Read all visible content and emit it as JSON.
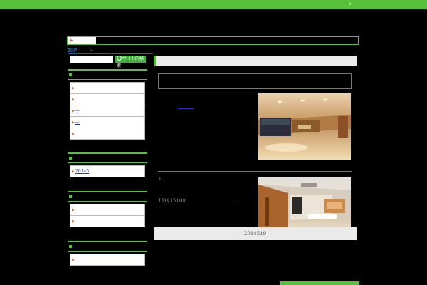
{
  "header": {
    "top_right_arrow": "›"
  },
  "breadcrumb": {
    "home": "TOP",
    "separator": ">"
  },
  "search": {
    "placeholder": "",
    "button_label": "サイト内検索"
  },
  "widgets": [
    {
      "items": [
        {
          "label": ""
        },
        {
          "label": ""
        },
        {
          "label": "—"
        },
        {
          "label": "—"
        },
        {
          "label": ""
        }
      ]
    },
    {
      "items": [
        {
          "label": "20145"
        }
      ]
    },
    {
      "items": [
        {
          "label": ""
        },
        {
          "label": ""
        }
      ]
    },
    {
      "items": [
        {
          "label": ""
        }
      ]
    }
  ],
  "post": {
    "number": "1",
    "ldk": "LDK15100",
    "date": "2014519"
  },
  "colors": {
    "accent": "#58c13b",
    "marker": "#e86b1c",
    "link": "#1f2fc8"
  }
}
